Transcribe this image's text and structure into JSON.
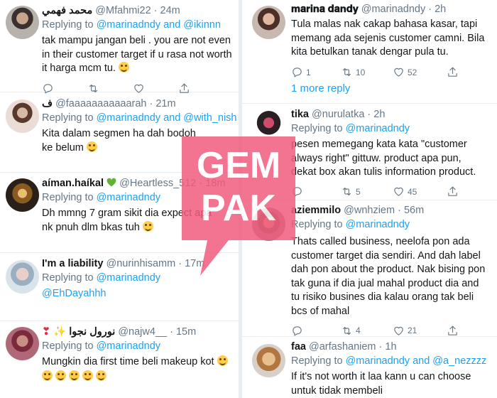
{
  "left": {
    "tweets": [
      {
        "name": "محمد فهمي",
        "handle": "@Mfahmi22 · 24m",
        "reply_prefix": "Replying to",
        "reply_to": "@marinadndy and @ikinnn",
        "text": "tak mampu jangan beli . you are not even in their customer target if u rasa not worth it harga mcm tu."
      },
      {
        "name": "ف",
        "handle": "@faaaaaaaaaaarah · 21m",
        "reply_prefix": "Replying to",
        "reply_to": "@marinadndy and @with_nish",
        "text": "Kita dalam segmen ha dah bodoh ke belum"
      },
      {
        "name": "aíman.haíkal",
        "handle": "@Heartless_512 · 18m",
        "reply_prefix": "Replying to",
        "reply_to": "@marinadndy",
        "text": "Dh mmng 7 gram sikit dia expect apa nk pnuh dlm bkas tuh"
      },
      {
        "name": "I'm a liability",
        "handle": "@nurinhisamm · 17m",
        "reply_prefix": "Replying to",
        "reply_to": "@marinadndy",
        "text": "@EhDayahhh"
      },
      {
        "name": "نورول نجوا",
        "handle": "@najw4__ · 15m",
        "reply_prefix": "Replying to",
        "reply_to": "@marinadndy",
        "text": "Mungkin dia first time beli makeup kot"
      }
    ]
  },
  "right": {
    "tweets": [
      {
        "name": "𝐦𝐚𝐫𝐢𝐧𝐚 𝐝𝐚𝐧𝐝𝐲",
        "handle": "@marinadndy · 2h",
        "text": "Tula malas nak cakap bahasa kasar, tapi memang ada sejenis customer camni. Bila kita betulkan tanak dengar pula tu.",
        "replies": "1",
        "retweets": "10",
        "likes": "52"
      },
      {
        "name": "tika",
        "handle": "@nurulatka · 2h",
        "reply_prefix": "Replying to",
        "reply_to": "@marinadndy",
        "text": "pesen memegang kata kata \"customer always right\" gittuw. product apa pun, dekat box akan tulis information product.",
        "retweets": "5",
        "likes": "45"
      },
      {
        "name": "aziemmilo",
        "handle": "@wnhziem · 56m",
        "reply_prefix": "Replying to",
        "reply_to": "@marinadndy",
        "text": "Thats called business, neelofa pon ada customer target dia sendiri. And dah label dah pon about the product. Nak bising pon tak guna if dia jual mahal product dia and tu risiko busines dia kalau orang tak beli bcs of mahal",
        "retweets": "4",
        "likes": "21"
      },
      {
        "name": "faa",
        "handle": "@arfashaniem · 1h",
        "reply_prefix": "Replying to",
        "reply_to": "@marinadndy and @a_nezzzz",
        "text": "If it's not worth it laa kann u can choose untuk tidak membeli"
      }
    ],
    "more_link": "1 more reply"
  },
  "watermark": {
    "line1": "GEM",
    "line2": "PAK",
    "color": "#f25c7e"
  },
  "colors": {
    "link": "#1da1f2",
    "muted": "#657786",
    "border": "#e6ecf0"
  }
}
